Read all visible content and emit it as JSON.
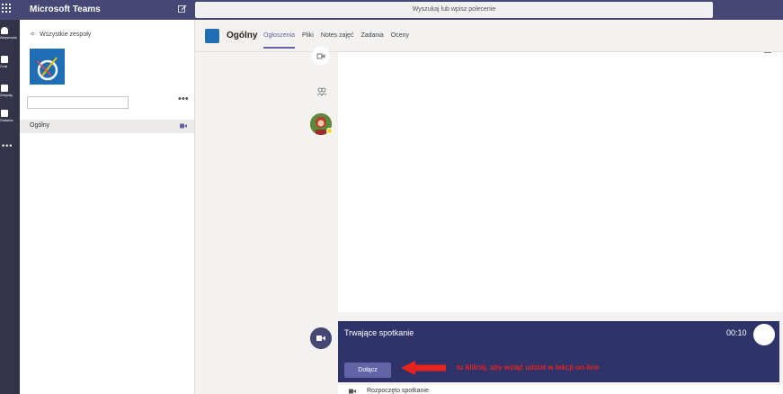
{
  "app": {
    "title": "Microsoft Teams"
  },
  "search": {
    "placeholder": "Wyszukaj lub wpisz polecenie"
  },
  "rail": {
    "items": [
      {
        "label": "Aktywność",
        "icon": "bell-icon"
      },
      {
        "label": "Czat",
        "icon": "chat-icon"
      },
      {
        "label": "Zespoły",
        "icon": "teams-icon"
      },
      {
        "label": "Zadania",
        "icon": "assignments-icon"
      }
    ],
    "more": "•••"
  },
  "team": {
    "back_label": "Wszystkie zespoły",
    "more": "•••",
    "channels": [
      {
        "label": "Ogólny"
      }
    ]
  },
  "channel": {
    "name": "Ogólny",
    "tabs": [
      "Ogłoszenia",
      "Pliki",
      "Notes zajęć",
      "Zadania",
      "Oceny"
    ],
    "active_tab": "Ogłoszenia"
  },
  "meeting": {
    "title": "Trwające spotkanie",
    "time": "00:10",
    "join_label": "Dołącz",
    "started_label": "Rozpoczęto spotkanie"
  },
  "annotation": {
    "text": "tu kliknij, aby wziąć udział w lekcji on-line",
    "color": "#e8231e"
  },
  "colors": {
    "topbar": "#464775",
    "rail": "#33344a",
    "accent": "#6264a7",
    "meeting_card": "#2e3369"
  }
}
